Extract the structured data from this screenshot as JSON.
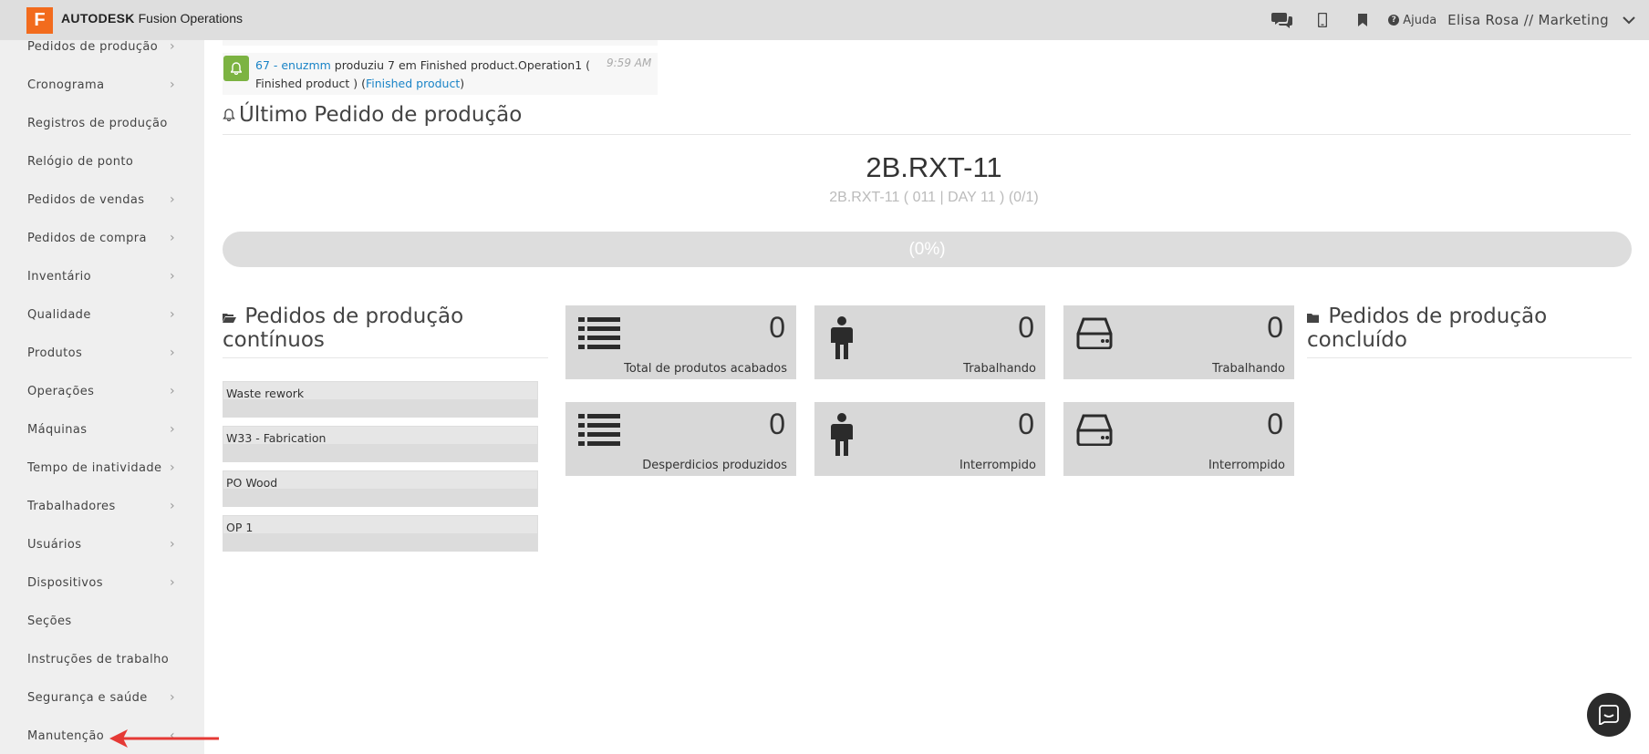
{
  "header": {
    "logo_letter": "F",
    "brand_bold": "AUTODESK",
    "brand_rest": "Fusion Operations",
    "help_label": "Ajuda",
    "user_label": "Elisa Rosa // Marketing",
    "icons": [
      "chat-icon",
      "mobile-icon",
      "bookmark-icon",
      "help-icon",
      "chevron-down-icon"
    ]
  },
  "sidebar": {
    "items": [
      {
        "label": "Pedidos de produção",
        "arrow": "›"
      },
      {
        "label": "Cronograma",
        "arrow": "›"
      },
      {
        "label": "Registros de produção",
        "arrow": ""
      },
      {
        "label": "Relógio de ponto",
        "arrow": ""
      },
      {
        "label": "Pedidos de vendas",
        "arrow": "›"
      },
      {
        "label": "Pedidos de compra",
        "arrow": "›"
      },
      {
        "label": "Inventário",
        "arrow": "›"
      },
      {
        "label": "Qualidade",
        "arrow": "›"
      },
      {
        "label": "Produtos",
        "arrow": "›"
      },
      {
        "label": "Operações",
        "arrow": "›"
      },
      {
        "label": "Máquinas",
        "arrow": "›"
      },
      {
        "label": "Tempo de inatividade",
        "arrow": "›"
      },
      {
        "label": "Trabalhadores",
        "arrow": "›"
      },
      {
        "label": "Usuários",
        "arrow": "›"
      },
      {
        "label": "Dispositivos",
        "arrow": "›"
      },
      {
        "label": "Seções",
        "arrow": ""
      },
      {
        "label": "Instruções de trabalho",
        "arrow": ""
      },
      {
        "label": "Segurança e saúde",
        "arrow": "›"
      },
      {
        "label": "Manutenção",
        "arrow": "‹"
      }
    ]
  },
  "notification": {
    "user_link": "67 - enuzmm",
    "text_mid": " produziu 7 em Finished product.Operation1 ( Finished product ) (",
    "product_link": "Finished product",
    "text_end": ")",
    "time": "9:59 AM"
  },
  "latest": {
    "title": "Último Pedido de produção",
    "order_code": "2B.RXT-11",
    "order_sub": "2B.RXT-11 ( 011 | DAY 11 ) (0/1)",
    "progress_label": "(0%)",
    "progress_fraction": 0
  },
  "continuous": {
    "title": "Pedidos de produção contínuos",
    "items": [
      "Waste rework",
      "W33 - Fabrication",
      "PO Wood",
      "OP 1"
    ]
  },
  "stats": [
    {
      "value": "0",
      "caption": "Total de produtos acabados",
      "icon": "list-icon"
    },
    {
      "value": "0",
      "caption": "Trabalhando",
      "icon": "person-icon"
    },
    {
      "value": "0",
      "caption": "Trabalhando",
      "icon": "machine-icon"
    },
    {
      "value": "0",
      "caption": "Desperdicios produzidos",
      "icon": "list-icon"
    },
    {
      "value": "0",
      "caption": "Interrompido",
      "icon": "person-icon"
    },
    {
      "value": "0",
      "caption": "Interrompido",
      "icon": "machine-icon"
    }
  ],
  "completed": {
    "title": "Pedidos de produção concluído"
  },
  "colors": {
    "brand": "#f26b1d",
    "topbar": "#dedede",
    "sidebar": "#efefef",
    "link": "#1a84c7",
    "notif_icon": "#7cb342",
    "card": "#d8d8d8",
    "annotation_arrow": "#e53935"
  }
}
